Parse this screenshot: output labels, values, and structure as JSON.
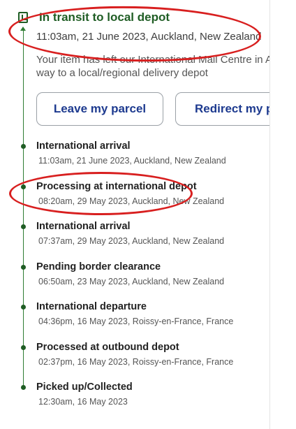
{
  "current_status": {
    "title": "In transit to local depot",
    "datetime": "11:03am, 21 June 2023, Auckland, New Zealand",
    "description_lines": [
      "Your item has left our International Mail Centre in A",
      "way to a local/regional delivery depot"
    ]
  },
  "buttons": {
    "leave_parcel": "Leave my parcel",
    "redirect_parcel": "Redirect my p"
  },
  "events": [
    {
      "title": "International arrival",
      "detail": "11:03am, 21 June 2023, Auckland, New Zealand"
    },
    {
      "title": "Processing at international depot",
      "detail": "08:20am, 29 May 2023, Auckland, New Zealand"
    },
    {
      "title": "International arrival",
      "detail": "07:37am, 29 May 2023, Auckland, New Zealand"
    },
    {
      "title": "Pending border clearance",
      "detail": "06:50am, 23 May 2023, Auckland, New Zealand"
    },
    {
      "title": "International departure",
      "detail": "04:36pm, 16 May 2023, Roissy-en-France, France"
    },
    {
      "title": "Processed at outbound depot",
      "detail": "02:37pm, 16 May 2023, Roissy-en-France, France"
    },
    {
      "title": "Picked up/Collected",
      "detail": "12:30am, 16 May 2023"
    }
  ],
  "colors": {
    "accent_green": "#1f5d24",
    "button_text_blue": "#1d3a8f",
    "annotation_red": "#d81f1f"
  },
  "icons": {
    "current_status_icon": "parcel-box-icon",
    "timeline_dot": "timeline-dot-icon"
  }
}
